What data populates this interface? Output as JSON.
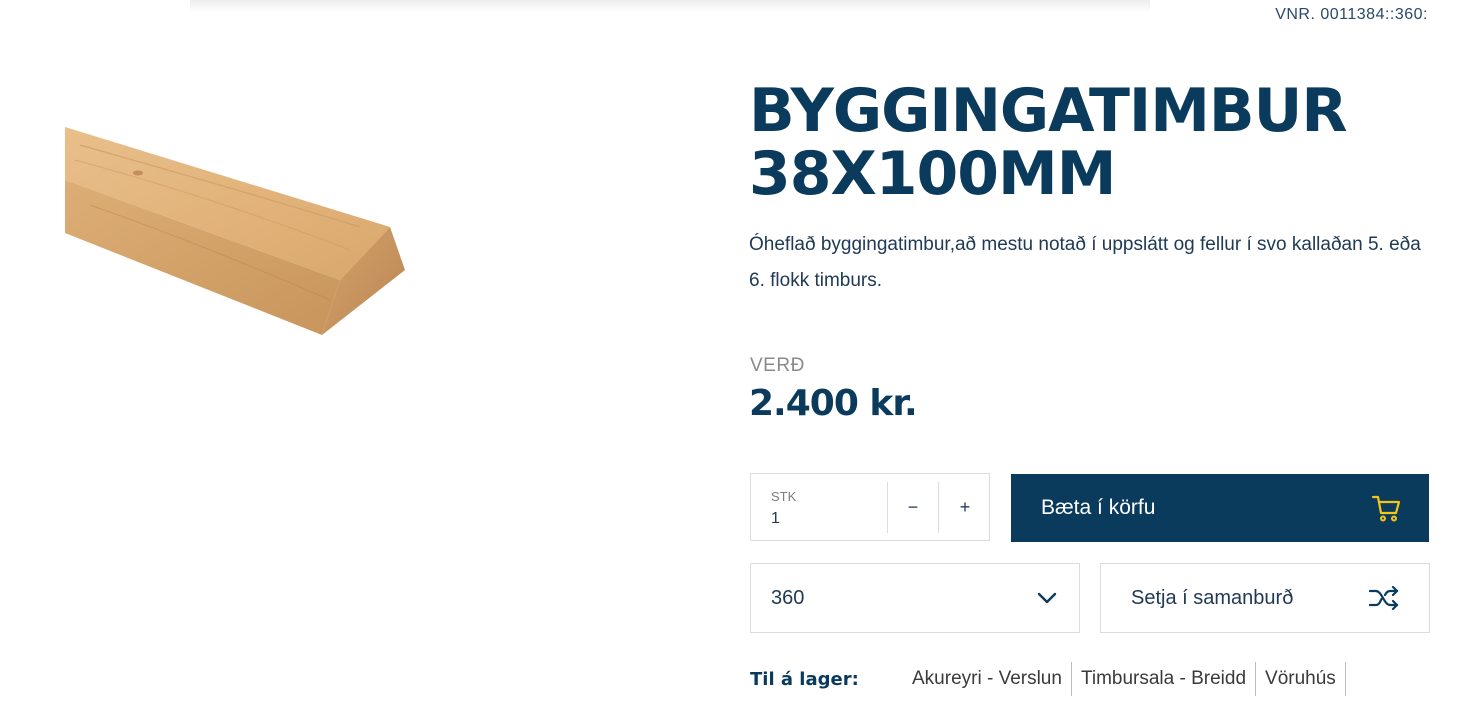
{
  "product": {
    "sku": "VNR. 0011384::360:",
    "title_line1": "BYGGINGATIMBUR",
    "title_line2": "38X100MM",
    "description": "Óheflað byggingatimbur,að mestu notað í uppslátt og fellur í svo kallaðan 5. eða 6. flokk timburs.",
    "image_icon": "timber-plank-image"
  },
  "price": {
    "label": "VERÐ",
    "value": "2.400 kr."
  },
  "quantity": {
    "label": "STK",
    "value": "1",
    "minus": "−",
    "plus": "+"
  },
  "cart": {
    "label": "Bæta í körfu",
    "icon": "cart-icon",
    "icon_color": "#f5c518"
  },
  "store_select": {
    "value": "360",
    "icon": "chevron-down-icon"
  },
  "compare": {
    "label": "Setja í samanburð",
    "icon": "shuffle-icon"
  },
  "stock": {
    "label": "Til á lager:",
    "locations": [
      "Akureyri - Verslun",
      "Timbursala - Breidd",
      "Vöruhús"
    ]
  },
  "colors": {
    "brand_navy": "#0a3a5c",
    "accent_yellow": "#f5c518"
  }
}
